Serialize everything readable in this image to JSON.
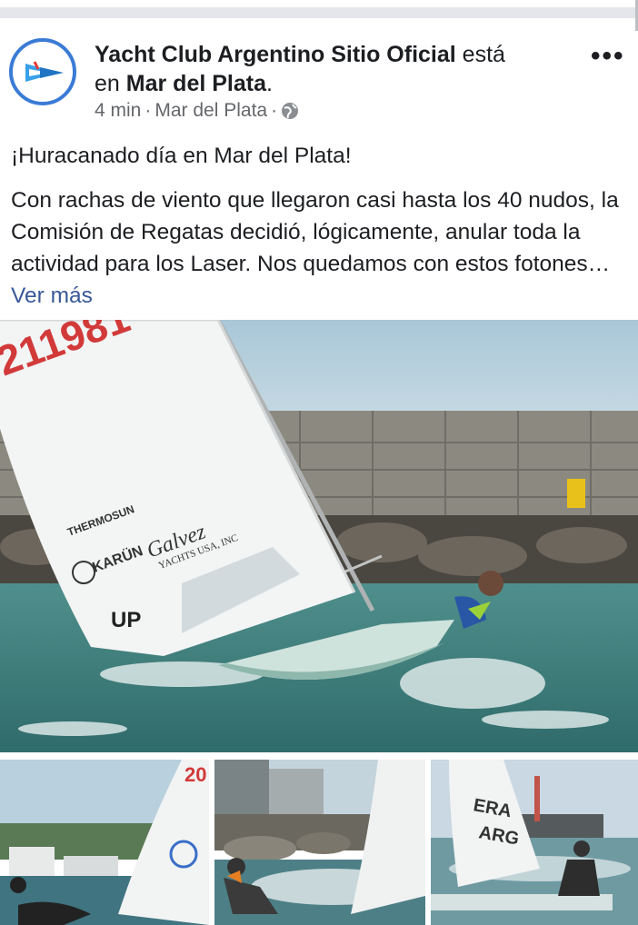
{
  "post": {
    "author_name": "Yacht Club Argentino Sitio Oficial",
    "author_verb_1": " está",
    "author_verb_2": "en ",
    "location_bold": "Mar del Plata",
    "location_dot": ".",
    "time": "4 min",
    "sep1": "·",
    "meta_location": "Mar del Plata",
    "sep2": "·",
    "text_line1": "¡Huracanado día en Mar del Plata!",
    "text_body": "Con rachas de viento que llegaron casi hasta los 40 nudos, la Comisión de Regatas decidió, lógicamente, anular toda la actividad para los Laser. Nos quedamos con estos fotones… ",
    "see_more": "Ver más",
    "more_menu": "•••"
  },
  "photos": {
    "main": {
      "sail_number": "211981",
      "sponsor_1": "THERMOSUN",
      "sponsor_2": "KARÜN",
      "sponsor_3": "Galvez",
      "sponsor_3b": "YACHTS USA, INC",
      "sail_mark": "UP"
    },
    "thumb1": {
      "sail_number": "20"
    },
    "thumb3": {
      "sail_text_1": "ERA",
      "sail_text_2": "ARG"
    }
  },
  "icons": {
    "globe": "globe-icon",
    "more": "more-options-icon",
    "avatar": "club-logo"
  },
  "colors": {
    "accent_blue": "#3a7bd5",
    "link": "#385898",
    "text": "#1c1e21",
    "secondary": "#65676b"
  }
}
